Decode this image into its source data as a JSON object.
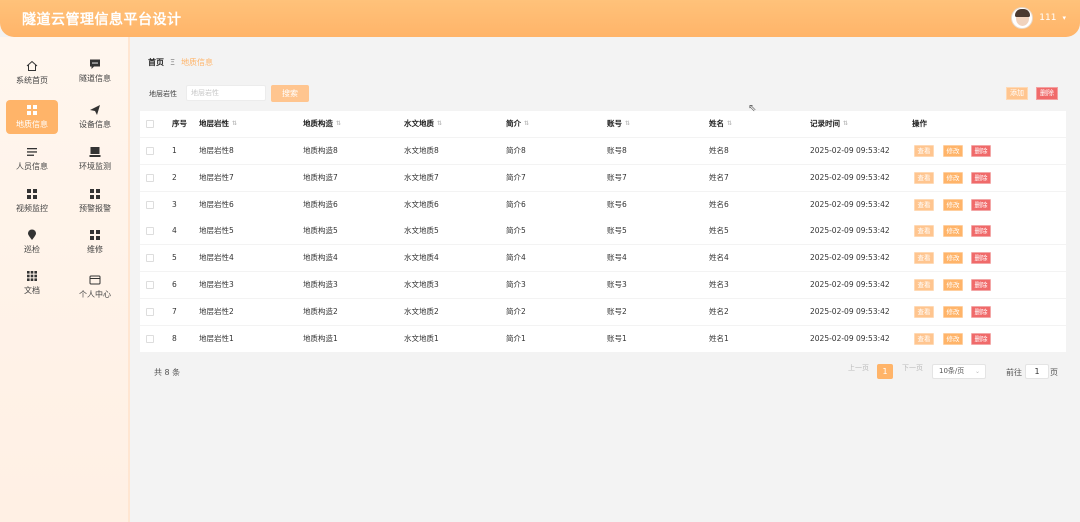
{
  "header": {
    "title": "隧道云管理信息平台设计",
    "username": "111"
  },
  "sidebar": {
    "items": [
      {
        "label": "系统首页",
        "icon": "home-icon"
      },
      {
        "label": "隧道信息",
        "icon": "message-icon"
      },
      {
        "label": "地质信息",
        "icon": "grid-icon",
        "active": true
      },
      {
        "label": "设备信息",
        "icon": "send-icon"
      },
      {
        "label": "人员信息",
        "icon": "list-icon"
      },
      {
        "label": "环境监测",
        "icon": "monitor-icon"
      },
      {
        "label": "视频监控",
        "icon": "grid-icon"
      },
      {
        "label": "预警报警",
        "icon": "grid-icon"
      },
      {
        "label": "巡检",
        "icon": "pin-icon"
      },
      {
        "label": "维修",
        "icon": "grid-icon"
      },
      {
        "label": "文档",
        "icon": "apps-icon"
      },
      {
        "label": "个人中心",
        "icon": "card-icon"
      }
    ]
  },
  "breadcrumb": {
    "home": "首页",
    "separator": "Ξ",
    "current": "地质信息"
  },
  "search": {
    "label": "地层岩性",
    "placeholder": "地层岩性",
    "button": "搜索"
  },
  "actions": {
    "add": "添加",
    "delete": "删除"
  },
  "table": {
    "columns": [
      "序号",
      "地层岩性",
      "地质构造",
      "水文地质",
      "简介",
      "账号",
      "姓名",
      "记录时间",
      "操作"
    ],
    "rows": [
      [
        "1",
        "地层岩性8",
        "地质构造8",
        "水文地质8",
        "简介8",
        "账号8",
        "姓名8",
        "2025-02-09 09:53:42"
      ],
      [
        "2",
        "地层岩性7",
        "地质构造7",
        "水文地质7",
        "简介7",
        "账号7",
        "姓名7",
        "2025-02-09 09:53:42"
      ],
      [
        "3",
        "地层岩性6",
        "地质构造6",
        "水文地质6",
        "简介6",
        "账号6",
        "姓名6",
        "2025-02-09 09:53:42"
      ],
      [
        "4",
        "地层岩性5",
        "地质构造5",
        "水文地质5",
        "简介5",
        "账号5",
        "姓名5",
        "2025-02-09 09:53:42"
      ],
      [
        "5",
        "地层岩性4",
        "地质构造4",
        "水文地质4",
        "简介4",
        "账号4",
        "姓名4",
        "2025-02-09 09:53:42"
      ],
      [
        "6",
        "地层岩性3",
        "地质构造3",
        "水文地质3",
        "简介3",
        "账号3",
        "姓名3",
        "2025-02-09 09:53:42"
      ],
      [
        "7",
        "地层岩性2",
        "地质构造2",
        "水文地质2",
        "简介2",
        "账号2",
        "姓名2",
        "2025-02-09 09:53:42"
      ],
      [
        "8",
        "地层岩性1",
        "地质构造1",
        "水文地质1",
        "简介1",
        "账号1",
        "姓名1",
        "2025-02-09 09:53:42"
      ]
    ],
    "row_actions": {
      "view": "查看",
      "edit": "修改",
      "delete": "删除"
    }
  },
  "footer": {
    "total": "共 8 条",
    "prev": "上一页",
    "current_page": "1",
    "next": "下一页",
    "page_size": "10条/页",
    "goto_label": "前往",
    "goto_value": "1",
    "goto_unit": "页"
  },
  "colors": {
    "accent": "#ffb469",
    "danger": "#f06a6a"
  }
}
